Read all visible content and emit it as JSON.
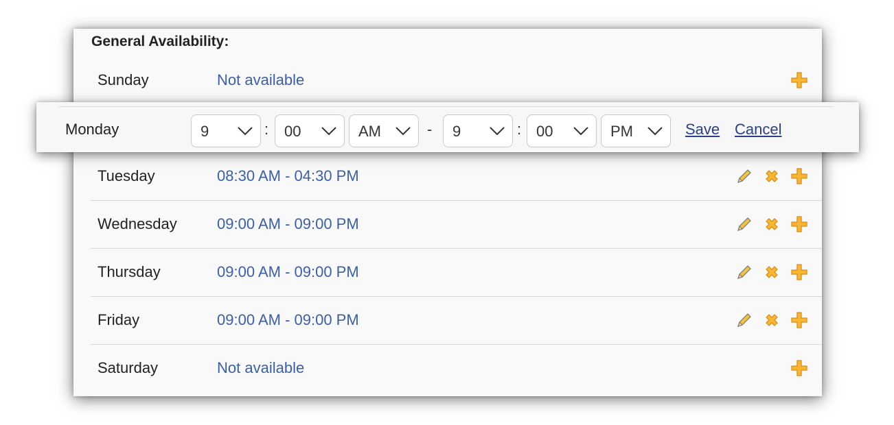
{
  "heading": "General Availability:",
  "rows": [
    {
      "day": "Sunday",
      "hours": "Not available",
      "actions": [
        "add"
      ]
    },
    {
      "day": "Tuesday",
      "hours": "08:30 AM - 04:30 PM",
      "actions": [
        "edit",
        "delete",
        "add"
      ]
    },
    {
      "day": "Wednesday",
      "hours": "09:00 AM - 09:00 PM",
      "actions": [
        "edit",
        "delete",
        "add"
      ]
    },
    {
      "day": "Thursday",
      "hours": "09:00 AM - 09:00 PM",
      "actions": [
        "edit",
        "delete",
        "add"
      ]
    },
    {
      "day": "Friday",
      "hours": "09:00 AM - 09:00 PM",
      "actions": [
        "edit",
        "delete",
        "add"
      ]
    },
    {
      "day": "Saturday",
      "hours": "Not available",
      "actions": [
        "add"
      ]
    }
  ],
  "editing": {
    "day": "Monday",
    "start_hour": "9",
    "start_minute": "00",
    "start_period": "AM",
    "range_separator": "-",
    "time_separator": ":",
    "end_hour": "9",
    "end_minute": "00",
    "end_period": "PM",
    "save_label": "Save",
    "cancel_label": "Cancel"
  },
  "icons": {
    "edit": "pencil-icon",
    "delete": "close-icon",
    "add": "plus-icon"
  },
  "colors": {
    "link": "#3a5fa8",
    "icon_orange": "#f5a623"
  }
}
